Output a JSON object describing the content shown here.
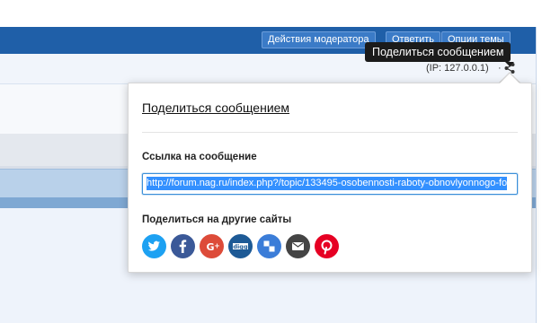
{
  "header": {
    "moderator_actions_label": "Действия модератора",
    "reply_label": "Ответить",
    "topic_options_label": "Опции темы"
  },
  "post_meta": {
    "ip_text": "(IP: 127.0.0.1)",
    "separator": "·"
  },
  "tooltip": {
    "text": "Поделиться сообщением"
  },
  "share_popup": {
    "title": "Поделиться сообщением",
    "link_label": "Ссылка на сообщение",
    "link_value": "http://forum.nag.ru/index.php?/topic/133495-osobennosti-raboty-obnovlyonnogo-fo",
    "share_label": "Поделиться на другие сайты",
    "networks": [
      {
        "name": "twitter",
        "icon": "twitter-icon",
        "color": "#1da1f2"
      },
      {
        "name": "facebook",
        "icon": "facebook-icon",
        "color": "#3b5998"
      },
      {
        "name": "google-plus",
        "icon": "google-plus-icon",
        "color": "#dd4b39"
      },
      {
        "name": "digg",
        "icon": "digg-icon",
        "color": "#2f6db3"
      },
      {
        "name": "delicious",
        "icon": "delicious-icon",
        "color": "#3b7dd8"
      },
      {
        "name": "email",
        "icon": "email-icon",
        "color": "#444444"
      },
      {
        "name": "pinterest",
        "icon": "pinterest-icon",
        "color": "#e60023"
      }
    ]
  },
  "colors": {
    "header_bar": "#1f5fa8",
    "header_button": "#3b7bc7",
    "tooltip_bg": "#1b1b1b",
    "link_selection": "#3390ff"
  }
}
